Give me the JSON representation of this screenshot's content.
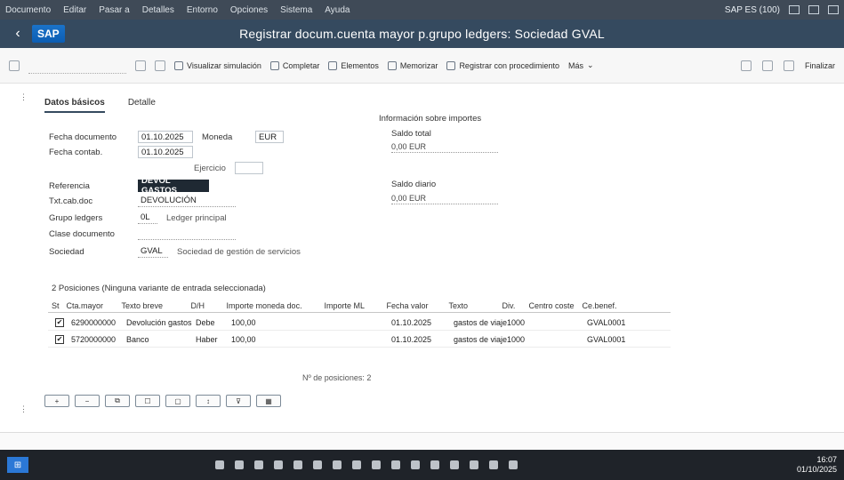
{
  "menubar": {
    "items": [
      "Documento",
      "Editar",
      "Pasar a",
      "Detalles",
      "Entorno",
      "Opciones",
      "Sistema",
      "Ayuda"
    ],
    "right_text": "SAP ES (100)"
  },
  "titlebar": {
    "title": "Registrar docum.cuenta mayor p.grupo ledgers: Sociedad GVAL",
    "logo": "SAP"
  },
  "toolbar": {
    "buttons": [
      {
        "label": "Visualizar simulación"
      },
      {
        "label": "Completar"
      },
      {
        "label": "Elementos"
      },
      {
        "label": "Memorizar"
      },
      {
        "label": "Registrar con procedimiento"
      },
      {
        "label": "Más"
      }
    ],
    "right_label": "Finalizar"
  },
  "tabs": [
    "Datos básicos",
    "Detalle"
  ],
  "form": {
    "fecha_doc_label": "Fecha documento",
    "fecha_doc_value": "01.10.2025",
    "moneda_label": "Moneda",
    "moneda_value": "EUR",
    "fecha_contab_label": "Fecha contab.",
    "fecha_contab_value": "01.10.2025",
    "ejercicio_label": "Ejercicio",
    "referencia_label": "Referencia",
    "referencia_value": "DEVOL GASTOS",
    "texto_cab_label": "Txt.cab.doc",
    "texto_cab_value": "DEVOLUCIÓN",
    "grupo_ledger_label": "Grupo ledgers",
    "grupo_ledger_value": "0L",
    "grupo_ledger_desc": "Ledger principal",
    "clase_doc_label": "Clase documento",
    "sociedad_label": "Sociedad",
    "sociedad_value": "GVAL",
    "sociedad_desc": "Sociedad de gestión de servicios"
  },
  "info_panel": {
    "title": "Información sobre importes",
    "saldo_label": "Saldo total",
    "saldo_value": "0,00 EUR",
    "saldo2_label": "Saldo diario",
    "saldo2_value": "0,00 EUR"
  },
  "items": {
    "title": "2 Posiciones (Ninguna variante de entrada seleccionada)",
    "headers": [
      "St",
      "Cta.mayor",
      "Texto breve",
      "D/H",
      "Importe moneda doc.",
      "Importe ML",
      "Fecha valor",
      "Texto",
      "Div.",
      "Centro coste",
      "Ce.benef."
    ],
    "rows": [
      {
        "cuenta": "6290000000",
        "texto": "Devolución gastos",
        "dh": "Debe",
        "importe": "100,00",
        "fecha": "01.10.2025",
        "texto2": "gastos de viaje",
        "div": "1000",
        "cebe": "GVAL0001"
      },
      {
        "cuenta": "5720000000",
        "texto": "Banco",
        "dh": "Haber",
        "importe": "100,00",
        "fecha": "01.10.2025",
        "texto2": "gastos de viaje",
        "div": "1000",
        "cebe": "GVAL0001"
      }
    ]
  },
  "total_line": "Nº de posiciones: 2",
  "bottom_buttons": [
    "",
    "",
    "",
    "",
    "",
    "",
    "",
    ""
  ],
  "taskbar": {
    "time": "16:07",
    "date": "01/10/2025"
  }
}
